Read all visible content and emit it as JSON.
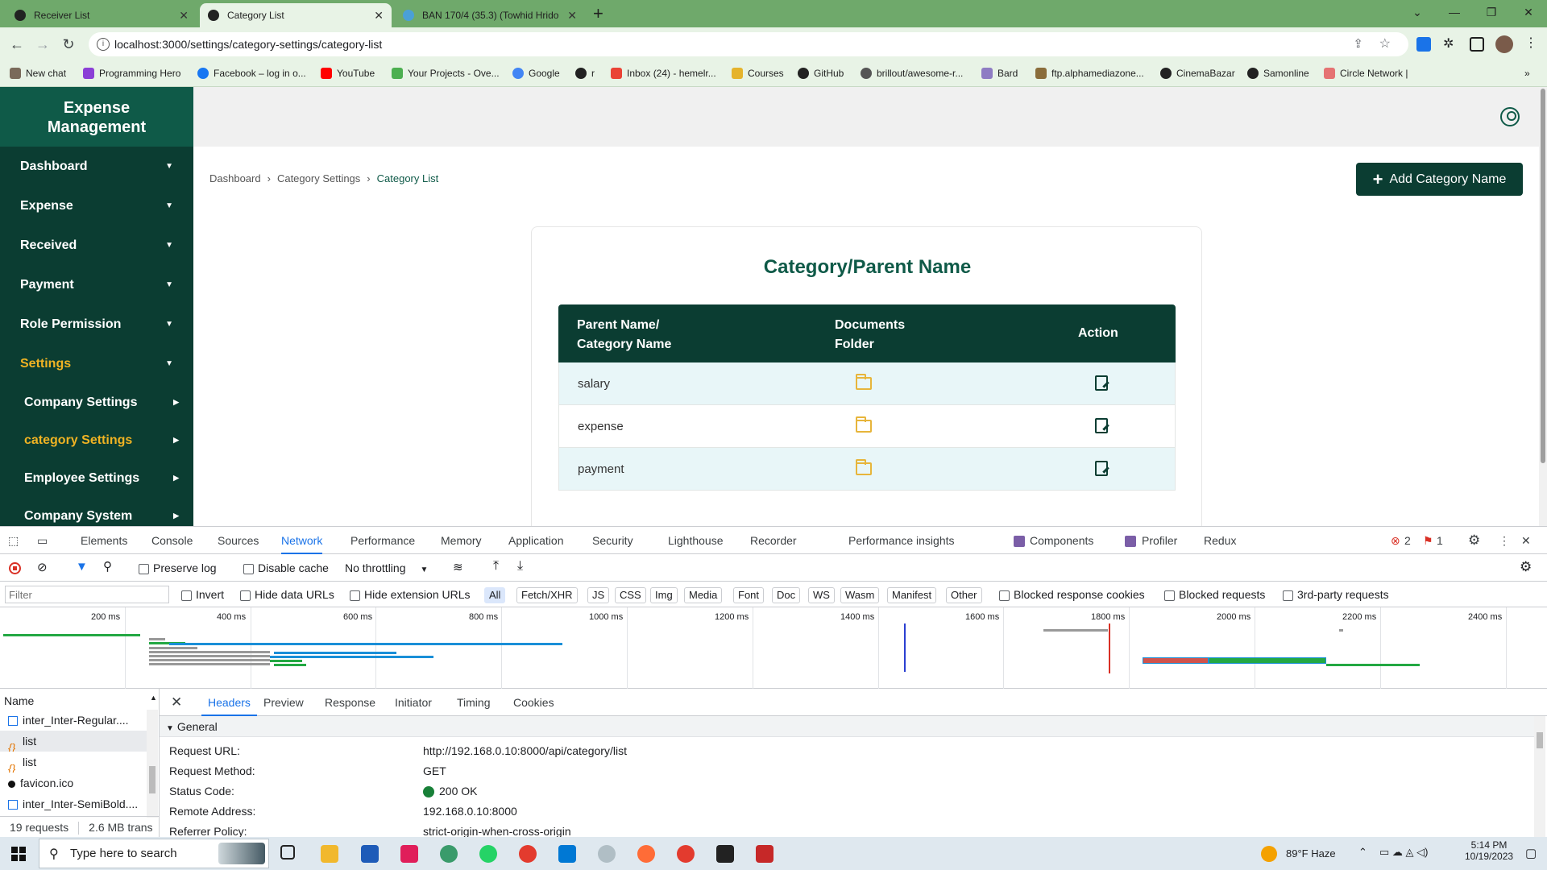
{
  "browser": {
    "tabs": [
      {
        "title": "Receiver List",
        "active": false
      },
      {
        "title": "Category List",
        "active": true
      },
      {
        "title": "BAN 170/4 (35.3) (Towhid Hrido",
        "active": false
      }
    ],
    "new_tab": "+",
    "url": "localhost:3000/settings/category-settings/category-list",
    "bookmarks": [
      "New chat",
      "Programming Hero",
      "Facebook – log in o...",
      "YouTube",
      "Your Projects - Ove...",
      "Google",
      "r",
      "Inbox (24) - hemelr...",
      "Courses",
      "GitHub",
      "brillout/awesome-r...",
      "Bard",
      "ftp.alphamediazone...",
      "CinemaBazar",
      "Samonline",
      "Circle Network |"
    ]
  },
  "app": {
    "brand": "Expense Management",
    "menu": [
      {
        "label": "Dashboard",
        "active": false
      },
      {
        "label": "Expense",
        "active": false
      },
      {
        "label": "Received",
        "active": false
      },
      {
        "label": "Payment",
        "active": false
      },
      {
        "label": "Role Permission",
        "active": false
      },
      {
        "label": "Settings",
        "active": true
      }
    ],
    "submenu": [
      {
        "label": "Company Settings",
        "active": false
      },
      {
        "label": "category Settings",
        "active": true
      },
      {
        "label": "Employee Settings",
        "active": false
      },
      {
        "label": "Company System",
        "active": false
      }
    ],
    "breadcrumb": [
      "Dashboard",
      "Category Settings",
      "Category List"
    ],
    "add_button": "Add Category Name",
    "card_title": "Category/Parent Name",
    "columns": [
      "Parent Name/\nCategory Name",
      "Documents\nFolder",
      "Action"
    ],
    "rows": [
      {
        "name": "salary"
      },
      {
        "name": "expense"
      },
      {
        "name": "payment"
      }
    ]
  },
  "devtools": {
    "tabs": [
      "Elements",
      "Console",
      "Sources",
      "Network",
      "Performance",
      "Memory",
      "Application",
      "Security",
      "Lighthouse",
      "Recorder",
      "Performance insights",
      "Components",
      "Profiler",
      "Redux"
    ],
    "selected_tab": "Network",
    "errors": "2",
    "warnings": "1",
    "toolbar": {
      "preserve_log": "Preserve log",
      "disable_cache": "Disable cache",
      "throttling": "No throttling"
    },
    "filter": {
      "placeholder": "Filter",
      "invert": "Invert",
      "hide_data": "Hide data URLs",
      "hide_ext": "Hide extension URLs",
      "types": [
        "All",
        "Fetch/XHR",
        "JS",
        "CSS",
        "Img",
        "Media",
        "Font",
        "Doc",
        "WS",
        "Wasm",
        "Manifest",
        "Other"
      ],
      "blocked_cookies": "Blocked response cookies",
      "blocked_requests": "Blocked requests",
      "third_party": "3rd-party requests"
    },
    "timeline_ticks": [
      "200 ms",
      "400 ms",
      "600 ms",
      "800 ms",
      "1000 ms",
      "1200 ms",
      "1400 ms",
      "1600 ms",
      "1800 ms",
      "2000 ms",
      "2200 ms",
      "2400 ms"
    ],
    "name_header": "Name",
    "requests": [
      "inter_Inter-Regular....",
      "list",
      "list",
      "favicon.ico",
      "inter_Inter-SemiBold...."
    ],
    "summary": "19 requests",
    "transferred": "2.6 MB trans",
    "detail_tabs": [
      "Headers",
      "Preview",
      "Response",
      "Initiator",
      "Timing",
      "Cookies"
    ],
    "general_label": "General",
    "headers": [
      {
        "k": "Request URL:",
        "v": "http://192.168.0.10:8000/api/category/list"
      },
      {
        "k": "Request Method:",
        "v": "GET"
      },
      {
        "k": "Status Code:",
        "v": "200 OK"
      },
      {
        "k": "Remote Address:",
        "v": "192.168.0.10:8000"
      },
      {
        "k": "Referrer Policy:",
        "v": "strict-origin-when-cross-origin"
      }
    ]
  },
  "taskbar": {
    "search": "Type here to search",
    "weather": "89°F  Haze",
    "time": "5:14 PM",
    "date": "10/19/2023"
  }
}
